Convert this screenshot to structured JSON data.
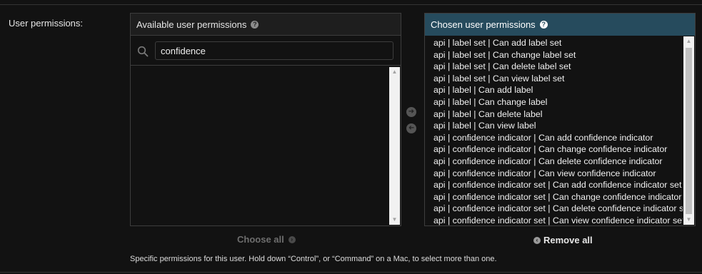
{
  "field": {
    "label": "User permissions:"
  },
  "available": {
    "title": "Available user permissions",
    "filter_value": "confidence",
    "options": []
  },
  "chosen": {
    "title": "Chosen user permissions",
    "options": [
      "api | label set | Can add label set",
      "api | label set | Can change label set",
      "api | label set | Can delete label set",
      "api | label set | Can view label set",
      "api | label | Can add label",
      "api | label | Can change label",
      "api | label | Can delete label",
      "api | label | Can view label",
      "api | confidence indicator | Can add confidence indicator",
      "api | confidence indicator | Can change confidence indicator",
      "api | confidence indicator | Can delete confidence indicator",
      "api | confidence indicator | Can view confidence indicator",
      "api | confidence indicator set | Can add confidence indicator set",
      "api | confidence indicator set | Can change confidence indicator set",
      "api | confidence indicator set | Can delete confidence indicator set",
      "api | confidence indicator set | Can view confidence indicator set"
    ]
  },
  "actions": {
    "choose_all": "Choose all",
    "remove_all": "Remove all"
  },
  "help_text": "Specific permissions for this user. Hold down “Control”, or “Command” on a Mac, to select more than one.",
  "icons": {
    "help": "question-circle-icon",
    "search": "search-icon",
    "add": "arrow-right-circle-icon",
    "remove": "arrow-left-circle-icon"
  },
  "colors": {
    "chosen_header": "#264b5d",
    "background": "#121212"
  }
}
